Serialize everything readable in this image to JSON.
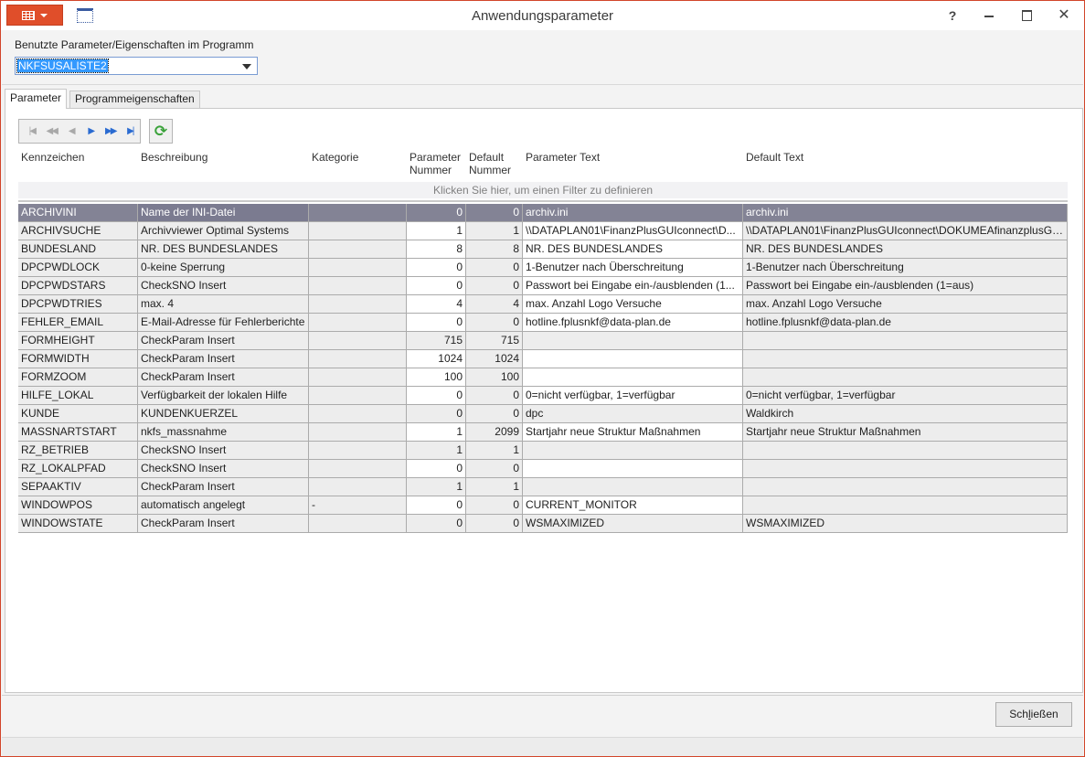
{
  "window": {
    "title": "Anwendungsparameter",
    "help_glyph": "?",
    "close_glyph": "✕"
  },
  "param_selector": {
    "label": "Benutzte Parameter/Eigenschaften im Programm",
    "selected": "NKFSUSALISTE2"
  },
  "tabs": [
    {
      "label": "Parameter",
      "active": true
    },
    {
      "label": "Programmeigenschaften",
      "active": false
    }
  ],
  "grid": {
    "columns": [
      {
        "line1": "Kennzeichen",
        "line2": ""
      },
      {
        "line1": "Beschreibung",
        "line2": ""
      },
      {
        "line1": "Kategorie",
        "line2": ""
      },
      {
        "line1": "Parameter",
        "line2": "Nummer"
      },
      {
        "line1": "Default",
        "line2": "Nummer"
      },
      {
        "line1": "Parameter Text",
        "line2": ""
      },
      {
        "line1": "Default Text",
        "line2": ""
      }
    ],
    "filter_hint": "Klicken Sie hier, um einen Filter zu definieren",
    "rows": [
      {
        "kennzeichen": "ARCHIVINI",
        "beschreibung": "Name der INI-Datei",
        "kategorie": "",
        "param_nr": "0",
        "default_nr": "0",
        "param_text": "archiv.ini",
        "default_text": "archiv.ini"
      },
      {
        "kennzeichen": "ARCHIVSUCHE",
        "beschreibung": "Archivviewer Optimal Systems",
        "kategorie": "",
        "param_nr": "1",
        "default_nr": "1",
        "param_text": "\\\\DATAPLAN01\\FinanzPlusGUIconnect\\D...",
        "default_text": "\\\\DATAPLAN01\\FinanzPlusGUIconnect\\DOKUMEAfinanzplusGU..."
      },
      {
        "kennzeichen": "BUNDESLAND",
        "beschreibung": "NR. DES BUNDESLANDES",
        "kategorie": "",
        "param_nr": "8",
        "default_nr": "8",
        "param_text": "NR. DES BUNDESLANDES",
        "default_text": "NR. DES BUNDESLANDES"
      },
      {
        "kennzeichen": "DPCPWDLOCK",
        "beschreibung": "0-keine Sperrung",
        "kategorie": "",
        "param_nr": "0",
        "default_nr": "0",
        "param_text": "1-Benutzer nach Überschreitung",
        "default_text": "1-Benutzer nach Überschreitung"
      },
      {
        "kennzeichen": "DPCPWDSTARS",
        "beschreibung": "CheckSNO Insert",
        "kategorie": "",
        "param_nr": "0",
        "default_nr": "0",
        "param_text": "Passwort bei Eingabe ein-/ausblenden (1...",
        "default_text": "Passwort bei Eingabe ein-/ausblenden (1=aus)"
      },
      {
        "kennzeichen": "DPCPWDTRIES",
        "beschreibung": "max. 4",
        "kategorie": "",
        "param_nr": "4",
        "default_nr": "4",
        "param_text": "max. Anzahl Logo Versuche",
        "default_text": "max. Anzahl Logo Versuche"
      },
      {
        "kennzeichen": "FEHLER_EMAIL",
        "beschreibung": "E-Mail-Adresse für Fehlerberichte",
        "kategorie": "",
        "param_nr": "0",
        "default_nr": "0",
        "param_text": "hotline.fplusnkf@data-plan.de",
        "default_text": "hotline.fplusnkf@data-plan.de"
      },
      {
        "kennzeichen": "FORMHEIGHT",
        "beschreibung": "CheckParam Insert",
        "kategorie": "",
        "param_nr": "715",
        "default_nr": "715",
        "param_text": "",
        "default_text": ""
      },
      {
        "kennzeichen": "FORMWIDTH",
        "beschreibung": "CheckParam Insert",
        "kategorie": "",
        "param_nr": "1024",
        "default_nr": "1024",
        "param_text": "",
        "default_text": ""
      },
      {
        "kennzeichen": "FORMZOOM",
        "beschreibung": "CheckParam Insert",
        "kategorie": "",
        "param_nr": "100",
        "default_nr": "100",
        "param_text": "",
        "default_text": ""
      },
      {
        "kennzeichen": "HILFE_LOKAL",
        "beschreibung": "Verfügbarkeit der lokalen Hilfe",
        "kategorie": "",
        "param_nr": "0",
        "default_nr": "0",
        "param_text": "0=nicht verfügbar, 1=verfügbar",
        "default_text": "0=nicht verfügbar, 1=verfügbar"
      },
      {
        "kennzeichen": "KUNDE",
        "beschreibung": "KUNDENKUERZEL",
        "kategorie": "",
        "param_nr": "0",
        "default_nr": "0",
        "param_text": "dpc",
        "default_text": "Waldkirch"
      },
      {
        "kennzeichen": "MASSNARTSTART",
        "beschreibung": "nkfs_massnahme",
        "kategorie": "",
        "param_nr": "1",
        "default_nr": "2099",
        "param_text": "Startjahr neue Struktur Maßnahmen",
        "default_text": "Startjahr neue Struktur Maßnahmen"
      },
      {
        "kennzeichen": "RZ_BETRIEB",
        "beschreibung": "CheckSNO Insert",
        "kategorie": "",
        "param_nr": "1",
        "default_nr": "1",
        "param_text": "",
        "default_text": ""
      },
      {
        "kennzeichen": "RZ_LOKALPFAD",
        "beschreibung": "CheckSNO Insert",
        "kategorie": "",
        "param_nr": "0",
        "default_nr": "0",
        "param_text": "",
        "default_text": ""
      },
      {
        "kennzeichen": "SEPAAKTIV",
        "beschreibung": "CheckParam Insert",
        "kategorie": "",
        "param_nr": "1",
        "default_nr": "1",
        "param_text": "",
        "default_text": ""
      },
      {
        "kennzeichen": "WINDOWPOS",
        "beschreibung": "automatisch angelegt",
        "kategorie": "-",
        "param_nr": "0",
        "default_nr": "0",
        "param_text": "CURRENT_MONITOR",
        "default_text": ""
      },
      {
        "kennzeichen": "WINDOWSTATE",
        "beschreibung": "CheckParam Insert",
        "kategorie": "",
        "param_nr": "0",
        "default_nr": "0",
        "param_text": "WSMAXIMIZED",
        "default_text": "WSMAXIMIZED"
      }
    ]
  },
  "footer": {
    "close_prefix": "Sch",
    "close_mnemonic": "l",
    "close_suffix": "ießen"
  }
}
